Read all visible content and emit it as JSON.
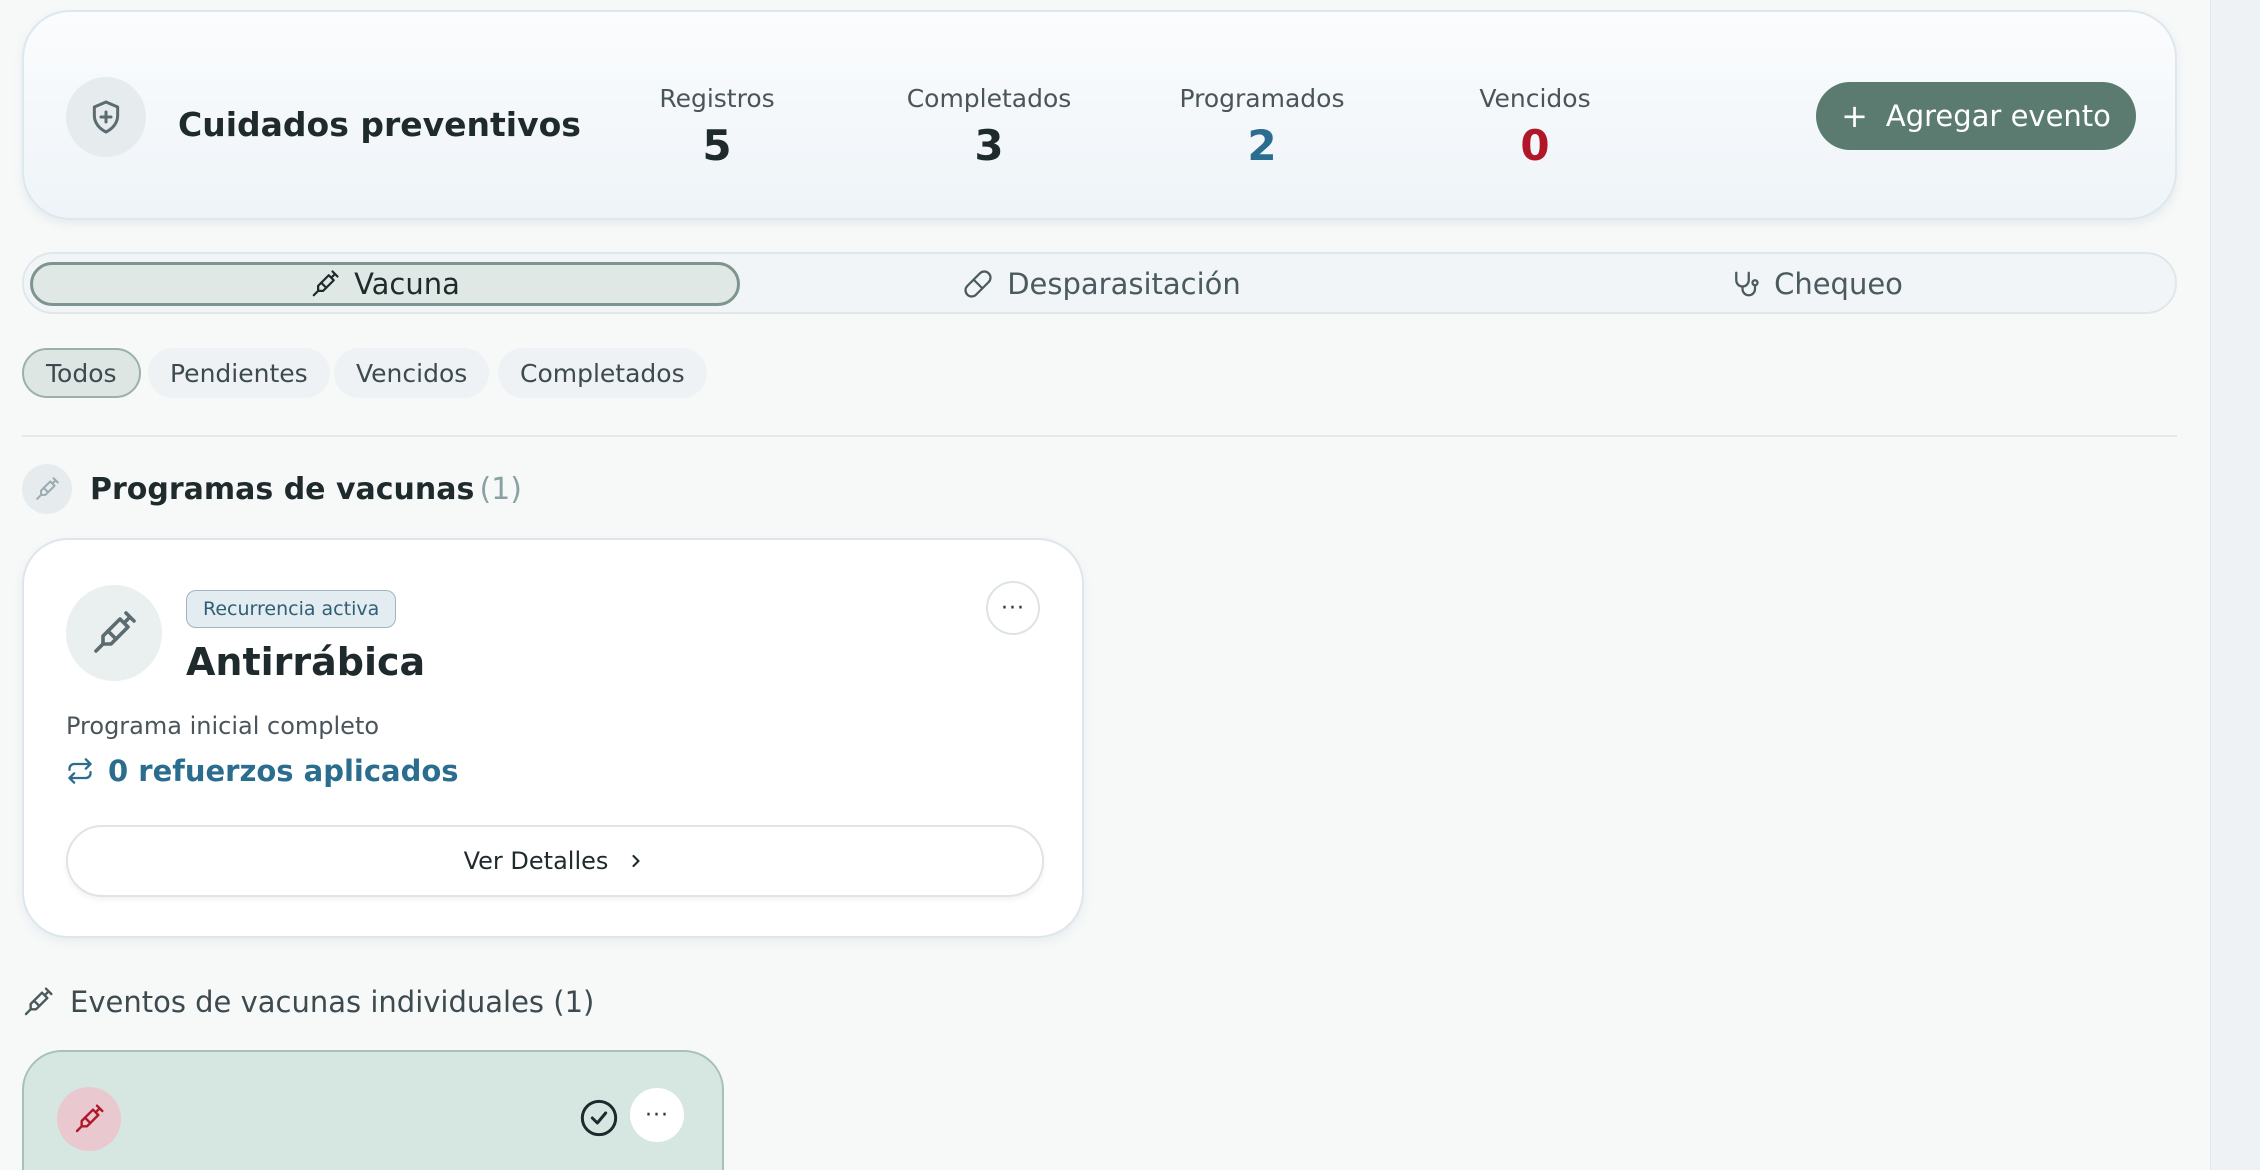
{
  "header": {
    "title": "Cuidados preventivos",
    "icon": "shield-plus-icon",
    "add_button_label": "Agregar evento"
  },
  "stats": [
    {
      "label": "Registros",
      "value": "5",
      "color": "#1f2a2d"
    },
    {
      "label": "Completados",
      "value": "3",
      "color": "#1f2a2d"
    },
    {
      "label": "Programados",
      "value": "2",
      "color": "#2a6d8e"
    },
    {
      "label": "Vencidos",
      "value": "0",
      "color": "#b0182a"
    }
  ],
  "tabs": [
    {
      "label": "Vacuna",
      "icon": "syringe-icon",
      "active": true
    },
    {
      "label": "Desparasitación",
      "icon": "pill-icon",
      "active": false
    },
    {
      "label": "Chequeo",
      "icon": "stethoscope-icon",
      "active": false
    }
  ],
  "filters": [
    {
      "label": "Todos",
      "active": true
    },
    {
      "label": "Pendientes",
      "active": false
    },
    {
      "label": "Vencidos",
      "active": false
    },
    {
      "label": "Completados",
      "active": false
    }
  ],
  "programs_section": {
    "title": "Programas de vacunas",
    "count": "(1)"
  },
  "program_card": {
    "badge": "Recurrencia activa",
    "title": "Antirrábica",
    "subtitle": "Programa inicial completo",
    "boosters": "0 refuerzos aplicados",
    "details_label": "Ver Detalles",
    "more": "···"
  },
  "events_section": {
    "title": "Eventos de vacunas individuales (1)"
  },
  "event_card": {
    "more": "···"
  },
  "colors": {
    "accent": "#5b7b70",
    "link": "#2a6d8e",
    "danger": "#b0182a"
  }
}
